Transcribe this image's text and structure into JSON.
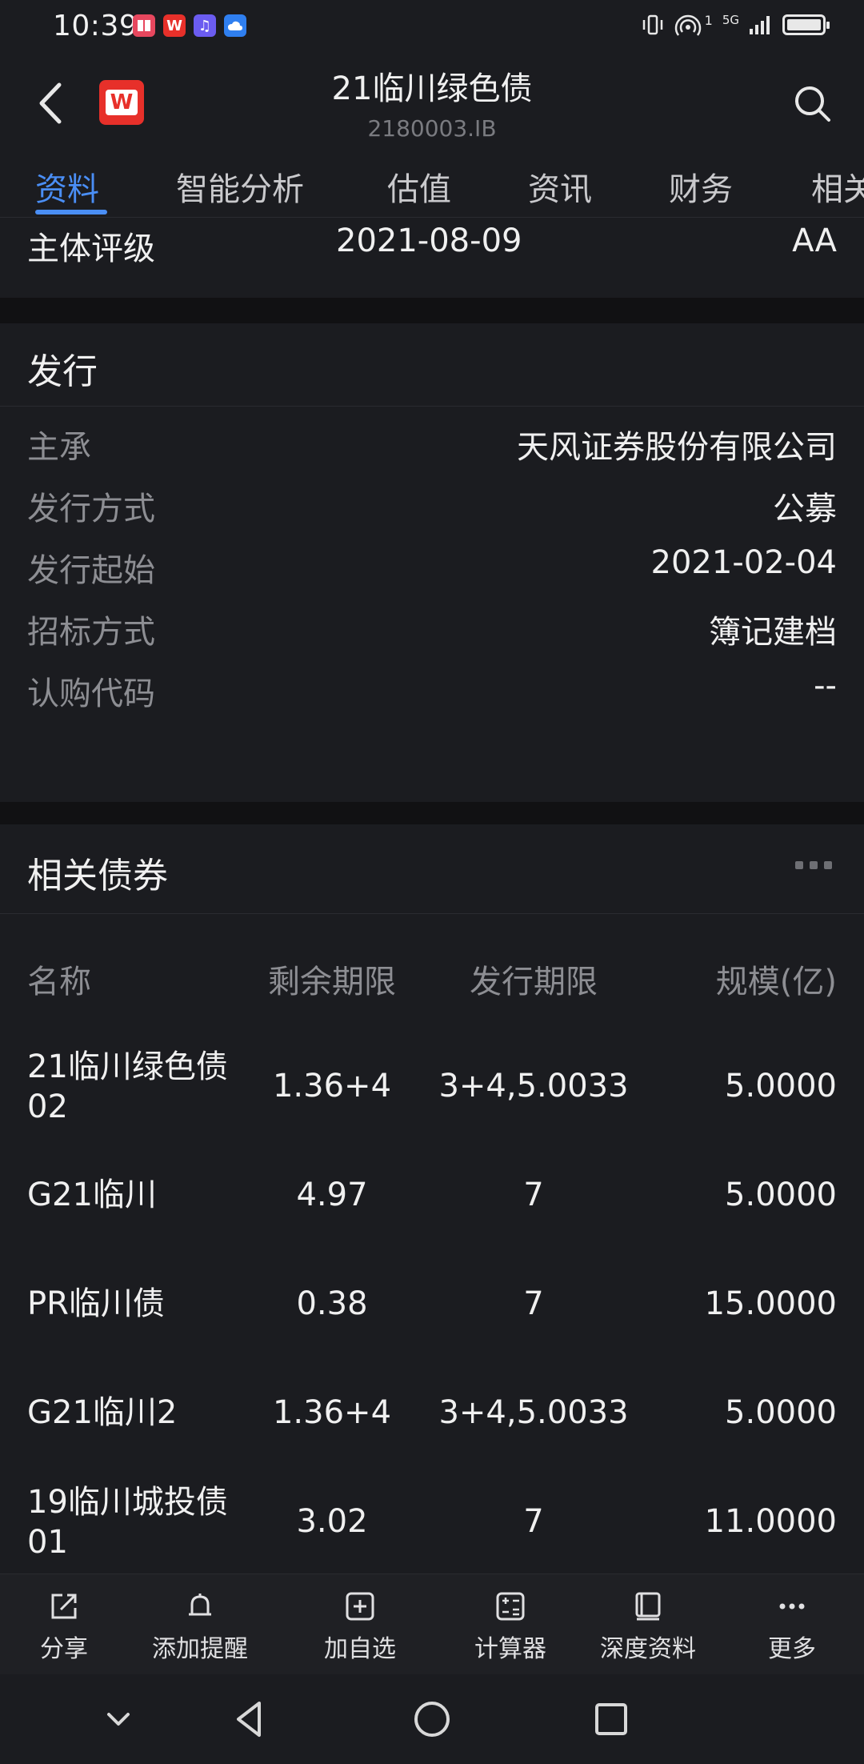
{
  "status_bar": {
    "time": "10:39",
    "network": "5G",
    "sim": "1"
  },
  "header": {
    "title": "21临川绿色债",
    "code": "2180003.IB",
    "logo_letter": "W"
  },
  "tabs": [
    {
      "label": "资料",
      "active": true
    },
    {
      "label": "智能分析",
      "active": false
    },
    {
      "label": "估值",
      "active": false
    },
    {
      "label": "资讯",
      "active": false
    },
    {
      "label": "财务",
      "active": false
    },
    {
      "label": "相关",
      "active": false
    }
  ],
  "rating": {
    "label": "主体评级",
    "date": "2021-08-09",
    "value": "AA"
  },
  "issuance": {
    "title": "发行",
    "rows": [
      {
        "label": "主承",
        "value": "天风证券股份有限公司"
      },
      {
        "label": "发行方式",
        "value": "公募"
      },
      {
        "label": "发行起始",
        "value": "2021-02-04"
      },
      {
        "label": "招标方式",
        "value": "簿记建档"
      },
      {
        "label": "认购代码",
        "value": "--"
      }
    ]
  },
  "related": {
    "title": "相关债券",
    "columns": [
      "名称",
      "剩余期限",
      "发行期限",
      "规模(亿)"
    ],
    "rows": [
      {
        "name": "21临川绿色债02",
        "remaining": "1.36+4",
        "term": "3+4,5.0033",
        "size": "5.0000"
      },
      {
        "name": "G21临川",
        "remaining": "4.97",
        "term": "7",
        "size": "5.0000"
      },
      {
        "name": "PR临川债",
        "remaining": "0.38",
        "term": "7",
        "size": "15.0000"
      },
      {
        "name": "G21临川2",
        "remaining": "1.36+4",
        "term": "3+4,5.0033",
        "size": "5.0000"
      },
      {
        "name": "19临川城投债01",
        "remaining": "3.02",
        "term": "7",
        "size": "11.0000"
      }
    ]
  },
  "actions": [
    {
      "label": "分享",
      "icon": "share-icon"
    },
    {
      "label": "添加提醒",
      "icon": "bell-icon"
    },
    {
      "label": "加自选",
      "icon": "add-box-icon"
    },
    {
      "label": "计算器",
      "icon": "calculator-icon"
    },
    {
      "label": "深度资料",
      "icon": "book-icon"
    },
    {
      "label": "更多",
      "icon": "more-icon"
    }
  ],
  "colors": {
    "accent": "#4a8ef5",
    "brand": "#e7302a",
    "background": "#111113",
    "panel": "#1b1c20"
  }
}
